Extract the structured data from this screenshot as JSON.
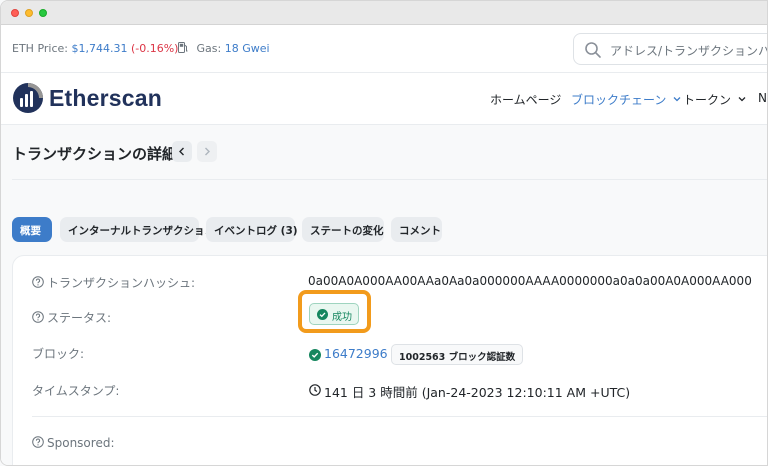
{
  "stats": {
    "eth_price_label": "ETH Price:",
    "eth_price_value": "$1,744.31",
    "eth_price_change": "(-0.16%)",
    "gas_label": "Gas:",
    "gas_value": "18 Gwei"
  },
  "search": {
    "placeholder": "アドレス/トランザクションハッシュ"
  },
  "header": {
    "logo_text": "Etherscan",
    "nav": {
      "home": "ホームページ",
      "blockchain": "ブロックチェーン",
      "tokens": "トークン",
      "more": "NF"
    }
  },
  "page": {
    "title": "トランザクションの詳細"
  },
  "tabs": {
    "overview": "概要",
    "internal": "インターナルトランザクション",
    "events": "イベントログ (3)",
    "state": "ステートの変化",
    "comments": "コメント"
  },
  "details": {
    "hash_label": "トランザクションハッシュ:",
    "hash_value": "0a00A0A000AA00AAa0Aa0a000000AAAA0000000a0a0a00A0A000AA000",
    "status_label": "ステータス:",
    "status_value": "成功",
    "block_label": "ブロック:",
    "block_number": "16472996",
    "block_confirmations": "1002563 ブロック認証数",
    "timestamp_label": "タイムスタンプ:",
    "timestamp_value": "141 日 3 時間前 (Jan-24-2023 12:10:11 AM +UTC)",
    "sponsored_label": "Sponsored:"
  },
  "colors": {
    "link": "#3d7cc9",
    "negative": "#dc3545",
    "success": "#16865f",
    "highlight": "#f29b1c",
    "logo": "#21325b"
  },
  "icons": [
    "gas-pump-icon",
    "search-icon",
    "etherscan-logo-icon",
    "chevron-down-icon",
    "chevron-left-icon",
    "chevron-right-icon",
    "help-circle-icon",
    "check-circle-icon",
    "clock-icon"
  ]
}
